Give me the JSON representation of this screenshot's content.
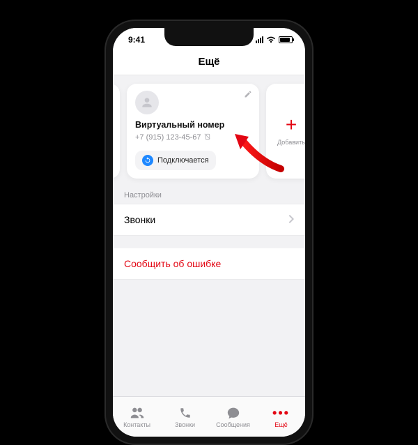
{
  "status": {
    "time": "9:41"
  },
  "nav": {
    "title": "Ещё"
  },
  "cards": {
    "virtual": {
      "title": "Виртуальный номер",
      "phone": "+7 (915) 123-45-67",
      "status": "Подключается"
    },
    "add": {
      "label": "Добавить",
      "plus": "+"
    }
  },
  "sections": {
    "settings_header": "Настройки",
    "calls": "Звонки",
    "report": "Сообщить об ошибке"
  },
  "tabs": {
    "contacts": "Контакты",
    "calls": "Звонки",
    "messages": "Сообщения",
    "more": "Ещё"
  }
}
